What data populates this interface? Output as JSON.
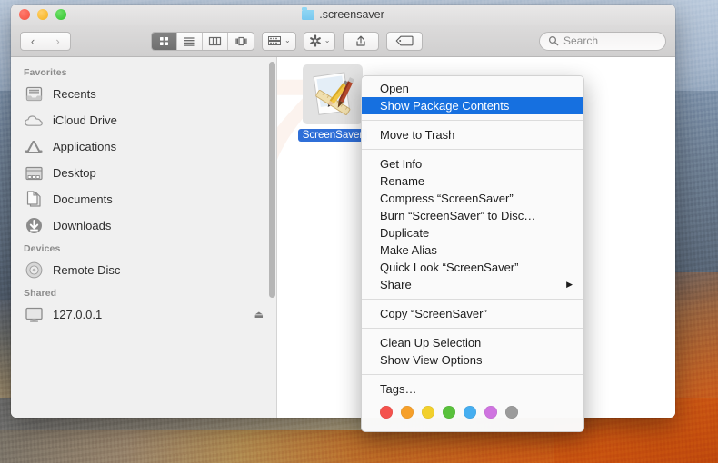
{
  "window": {
    "title": ".screensaver",
    "folder_icon": "folder-icon",
    "traffic_lights": [
      {
        "name": "close-button",
        "color": "#f4503f"
      },
      {
        "name": "minimize-button",
        "color": "#f5b01a"
      },
      {
        "name": "maximize-button",
        "color": "#2dc32a"
      }
    ]
  },
  "toolbar": {
    "back_label": "‹",
    "forward_label": "›",
    "view_modes": [
      {
        "name": "icon-view",
        "icon": "grid-icon",
        "active": true
      },
      {
        "name": "list-view",
        "icon": "list-icon",
        "active": false
      },
      {
        "name": "column-view",
        "icon": "columns-icon",
        "active": false
      },
      {
        "name": "gallery-view",
        "icon": "gallery-icon",
        "active": false
      }
    ],
    "group_button": {
      "name": "arrange-button",
      "icon": "arrange-icon",
      "caret": "⌄"
    },
    "action_button": {
      "name": "action-button",
      "icon": "gear-icon",
      "caret": "⌄"
    },
    "share_button": {
      "name": "share-button",
      "icon": "share-icon"
    },
    "tags_button": {
      "name": "tags-button",
      "icon": "tag-icon"
    },
    "search": {
      "placeholder": "Search",
      "icon": "search-icon",
      "value": ""
    }
  },
  "sidebar": {
    "groups": [
      {
        "label": "Favorites",
        "items": [
          {
            "label": "Recents",
            "icon": "recents-icon"
          },
          {
            "label": "iCloud Drive",
            "icon": "icloud-icon"
          },
          {
            "label": "Applications",
            "icon": "applications-icon"
          },
          {
            "label": "Desktop",
            "icon": "desktop-icon"
          },
          {
            "label": "Documents",
            "icon": "documents-icon"
          },
          {
            "label": "Downloads",
            "icon": "downloads-icon"
          }
        ]
      },
      {
        "label": "Devices",
        "items": [
          {
            "label": "Remote Disc",
            "icon": "disc-icon"
          }
        ]
      },
      {
        "label": "Shared",
        "items": [
          {
            "label": "127.0.0.1",
            "icon": "display-icon",
            "eject": "⏏"
          }
        ]
      }
    ]
  },
  "content": {
    "watermark": "7",
    "file": {
      "name": "ScreenSaver",
      "icon": "application-bundle-icon",
      "selected": true
    }
  },
  "context_menu": {
    "sections": [
      {
        "items": [
          {
            "label": "Open",
            "selected": false
          },
          {
            "label": "Show Package Contents",
            "selected": true
          }
        ]
      },
      {
        "items": [
          {
            "label": "Move to Trash",
            "selected": false
          }
        ]
      },
      {
        "items": [
          {
            "label": "Get Info",
            "selected": false
          },
          {
            "label": "Rename",
            "selected": false
          },
          {
            "label": "Compress “ScreenSaver”",
            "selected": false
          },
          {
            "label": "Burn “ScreenSaver” to Disc…",
            "selected": false
          },
          {
            "label": "Duplicate",
            "selected": false
          },
          {
            "label": "Make Alias",
            "selected": false
          },
          {
            "label": "Quick Look “ScreenSaver”",
            "selected": false
          },
          {
            "label": "Share",
            "selected": false,
            "submenu": "▶"
          }
        ]
      },
      {
        "items": [
          {
            "label": "Copy “ScreenSaver”",
            "selected": false
          }
        ]
      },
      {
        "items": [
          {
            "label": "Clean Up Selection",
            "selected": false
          },
          {
            "label": "Show View Options",
            "selected": false
          }
        ]
      },
      {
        "items": [
          {
            "label": "Tags…",
            "selected": false
          }
        ]
      }
    ],
    "tag_colors": [
      {
        "name": "red-tag",
        "hex": "#f4524d"
      },
      {
        "name": "orange-tag",
        "hex": "#f6a02a"
      },
      {
        "name": "yellow-tag",
        "hex": "#f2d02c"
      },
      {
        "name": "green-tag",
        "hex": "#59c13c"
      },
      {
        "name": "blue-tag",
        "hex": "#46aef0"
      },
      {
        "name": "purple-tag",
        "hex": "#c濃"
      },
      {
        "name": "gray-tag",
        "hex": "#9b9b9b"
      }
    ],
    "highlight_color": "#1670e0"
  }
}
